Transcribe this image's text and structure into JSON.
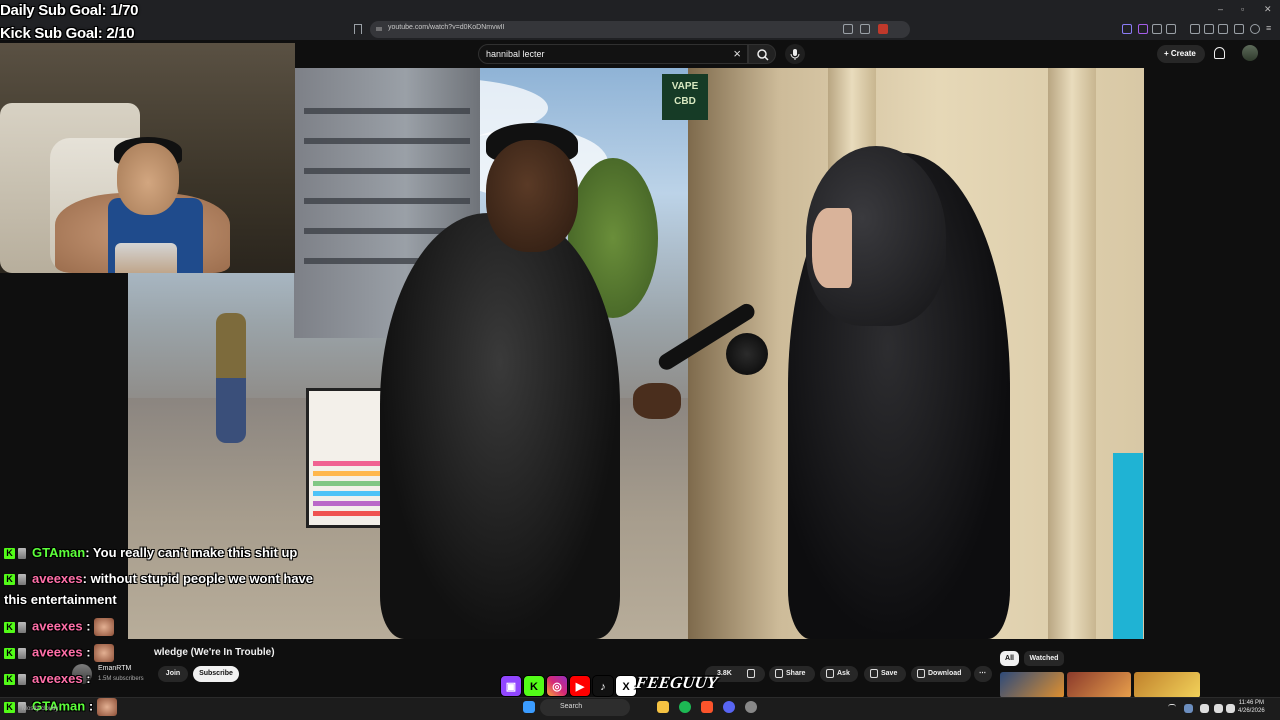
{
  "browser": {
    "url": "youtube.com/watch?v=d0KoDNmvwII"
  },
  "youtube": {
    "search_query": "hannibal lecter",
    "create_label": "Create",
    "video_title": "Zero General Knowledge (We're In Trouble)",
    "video_title_visible": "wledge (We're In Trouble)",
    "channel_name": "EmanRTM",
    "channel_subs": "1.5M subscribers",
    "join_label": "Join",
    "subscribe_label": "Subscribe",
    "like_count": "3.8K",
    "share_label": "Share",
    "ask_label": "Ask",
    "save_label": "Save",
    "download_label": "Download",
    "chip_all": "All",
    "chip_watched": "Watched"
  },
  "video_scene": {
    "sign_line1": "VAPE",
    "sign_line2": "CBD"
  },
  "overlay": {
    "daily_goal": "Daily Sub Goal: 1/70",
    "kick_goal": "Kick Sub Goal: 2/10",
    "brand": "FEEGUUY"
  },
  "chat": [
    {
      "user": "GTAman",
      "color": "#5cff3a",
      "message": ": You really can't make this shit up"
    },
    {
      "user": "aveexes",
      "color": "#ff6fa8",
      "message": ": without stupid people we wont have"
    },
    {
      "user": "",
      "color": "#ffffff",
      "message": "this entertainment"
    },
    {
      "user": "aveexes",
      "color": "#ff6fa8",
      "message": " :"
    },
    {
      "user": "aveexes",
      "color": "#ff6fa8",
      "message": " :"
    },
    {
      "user": "aveexes",
      "color": "#ff6fa8",
      "message": " :"
    },
    {
      "user": "GTAman",
      "color": "#5cff3a",
      "message": " :"
    }
  ],
  "taskbar": {
    "search_label": "Search",
    "time": "11:46 PM",
    "date": "4/26/2026",
    "weather": "Mostly cloudy"
  },
  "icons": {
    "socials": [
      "twitch-icon",
      "kick-icon",
      "instagram-icon",
      "youtube-icon",
      "tiktok-icon",
      "x-icon"
    ]
  }
}
